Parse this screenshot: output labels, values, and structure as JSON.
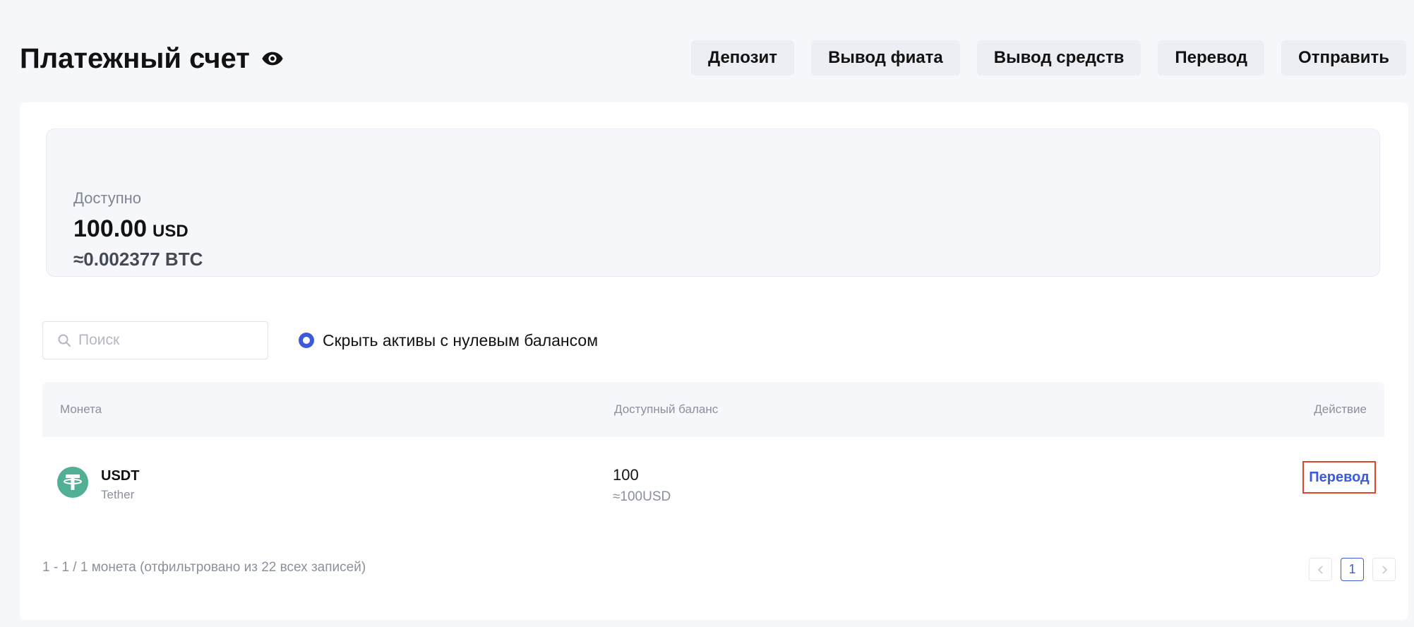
{
  "header": {
    "title": "Платежный счет",
    "actions": {
      "deposit": "Депозит",
      "fiat_withdraw": "Вывод фиата",
      "withdraw": "Вывод средств",
      "transfer": "Перевод",
      "send": "Отправить"
    }
  },
  "balance": {
    "label": "Доступно",
    "amount": "100.00",
    "currency": "USD",
    "btc_equivalent": "≈0.002377 BTC"
  },
  "filters": {
    "search_placeholder": "Поиск",
    "hide_zero_label": "Скрыть активы с нулевым балансом"
  },
  "table": {
    "columns": {
      "coin": "Монета",
      "balance": "Доступный баланс",
      "action": "Действие"
    },
    "rows": [
      {
        "symbol": "USDT",
        "name": "Tether",
        "balance": "100",
        "balance_usd": "≈100USD",
        "action": "Перевод"
      }
    ]
  },
  "footer": {
    "records_info": "1 - 1 / 1 монета (отфильтровано из 22 всех записей)",
    "current_page": "1"
  },
  "colors": {
    "accent": "#3b5bdb",
    "tether_green": "#50af95",
    "highlight_border": "#e0452c"
  }
}
